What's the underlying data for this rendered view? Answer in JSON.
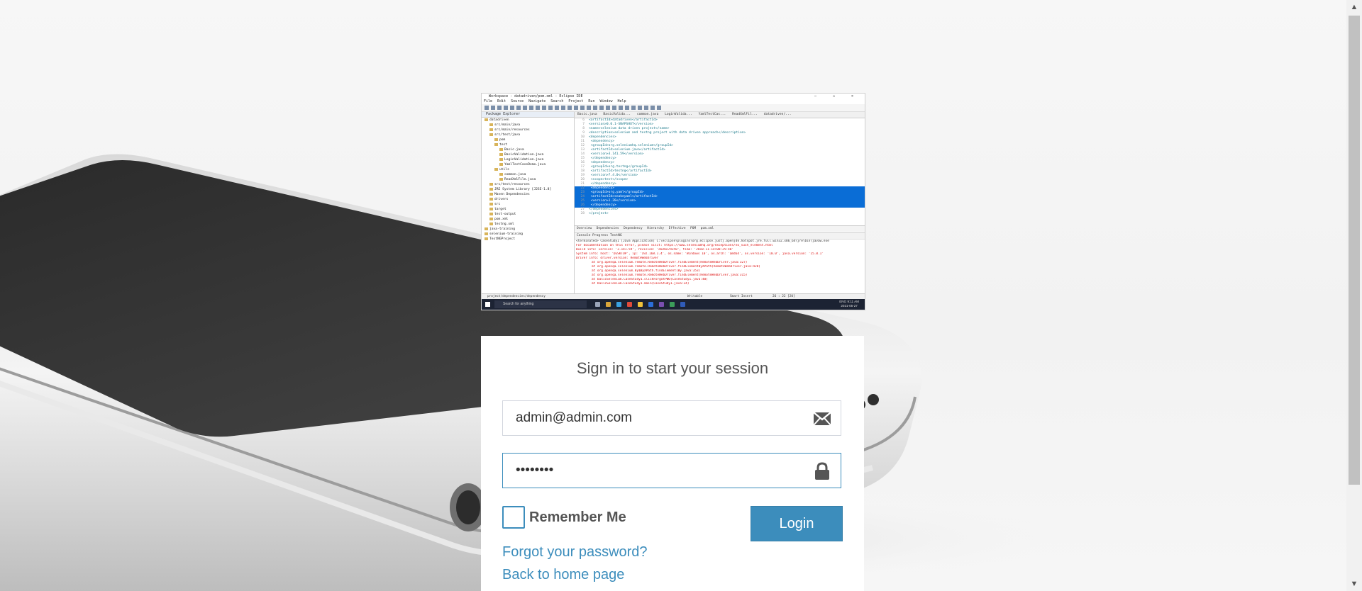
{
  "login": {
    "title": "Sign in to start your session",
    "email_value": "admin@admin.com",
    "password_value": "••••••••",
    "remember_label": "Remember Me",
    "login_button": "Login",
    "forgot_link": "Forgot your password?",
    "home_link": "Back to home page",
    "accent_color": "#3c8dbc"
  },
  "icons": {
    "email": "envelope-icon",
    "password": "lock-icon",
    "scroll_up": "chevron-up-icon",
    "scroll_down": "chevron-down-icon"
  },
  "ide": {
    "window_title": "Workspace - datadriven/pom.xml - Eclipse IDE",
    "menu": "File Edit Source Navigate Search Project Run Window Help",
    "package_explorer_title": "Package Explorer",
    "tree": [
      "datadriven",
      "src/main/java",
      "src/main/resources",
      "src/test/java",
      "pom",
      "test",
      "Basic.java",
      "BasicValidation.java",
      "LoginValidation.java",
      "YamlTestCaseDemo.java",
      "utils",
      "common.java",
      "ReadXmlFile.java",
      "src/test/resources",
      "JRE System Library [J2SE-1.8]",
      "Maven Dependencies",
      "drivers",
      "src",
      "target",
      "test-output",
      "pom.xml",
      "testng.xml",
      "java-training",
      "selenium-training",
      "TestNGProject"
    ],
    "editor_tabs": "Basic.java  BasicValida...  common.java  LoginValida...  YamlTestCas...  ReadXmlFil...  datadriven/...",
    "code": [
      {
        "ln": "6",
        "text": "<artifactId>datadriven</artifactId>",
        "sel": false
      },
      {
        "ln": "7",
        "text": "<version>0.0.1-SNAPSHOT</version>",
        "sel": false
      },
      {
        "ln": "8",
        "text": "<name>selenium data driven project</name>",
        "sel": false
      },
      {
        "ln": "9",
        "text": "<description>selenium and testng project with data driven approach</description>",
        "sel": false
      },
      {
        "ln": "10",
        "text": "<dependencies>",
        "sel": false
      },
      {
        "ln": "11",
        "text": "  <dependency>",
        "sel": false
      },
      {
        "ln": "12",
        "text": "    <groupId>org.seleniumhq.selenium</groupId>",
        "sel": false
      },
      {
        "ln": "13",
        "text": "    <artifactId>selenium-java</artifactId>",
        "sel": false
      },
      {
        "ln": "14",
        "text": "    <version>3.141.59</version>",
        "sel": false
      },
      {
        "ln": "15",
        "text": "  </dependency>",
        "sel": false
      },
      {
        "ln": "16",
        "text": "  <dependency>",
        "sel": false
      },
      {
        "ln": "17",
        "text": "    <groupId>org.testng</groupId>",
        "sel": false
      },
      {
        "ln": "18",
        "text": "    <artifactId>testng</artifactId>",
        "sel": false
      },
      {
        "ln": "19",
        "text": "    <version>7.4.0</version>",
        "sel": false
      },
      {
        "ln": "20",
        "text": "    <scope>test</scope>",
        "sel": false
      },
      {
        "ln": "21",
        "text": "  </dependency>",
        "sel": false
      },
      {
        "ln": "22",
        "text": "  <dependency>",
        "sel": true
      },
      {
        "ln": "23",
        "text": "    <groupId>org.yaml</groupId>",
        "sel": true
      },
      {
        "ln": "24",
        "text": "    <artifactId>snakeyaml</artifactId>",
        "sel": true
      },
      {
        "ln": "25",
        "text": "    <version>1.28</version>",
        "sel": true
      },
      {
        "ln": "26",
        "text": "  </dependency>",
        "sel": true
      },
      {
        "ln": "27",
        "text": "</dependencies>",
        "sel": false
      },
      {
        "ln": "28",
        "text": "</project>",
        "sel": false
      }
    ],
    "pom_tabs": "Overview  Dependencies  Dependency Hierarchy  Effective POM  pom.xml",
    "console_head": "Console  Progress  TestNG",
    "console_lines": [
      {
        "text": "<terminated> CaseStudy1 [Java Application] C:\\eclipse\\plugins\\org.eclipse.justj.openjdk.hotspot.jre.full.win32.x86_64\\jre\\bin\\javaw.exe",
        "indent": false
      },
      {
        "text": "For documentation on this error, please visit: https://www.seleniumhq.org/exceptions/no_such_element.html",
        "indent": false
      },
      {
        "text": "Build info: version: '3.141.59', revision: 'e82be7d358', time: '2018-11-14T08:25:48'",
        "indent": false
      },
      {
        "text": "System info: host: 'DESKTOP', ip: '192.168.1.4', os.name: 'Windows 10', os.arch: 'amd64', os.version: '10.0', java.version: '15.0.1'",
        "indent": false
      },
      {
        "text": "Driver info: driver.version: RemoteWebDriver",
        "indent": false
      },
      {
        "text": "at org.openqa.selenium.remote.RemoteWebDriver.findElement(RemoteWebDriver.java:327)",
        "indent": true
      },
      {
        "text": "at org.openqa.selenium.remote.RemoteWebDriver.findElementByXPath(RemoteWebDriver.java:428)",
        "indent": true
      },
      {
        "text": "at org.openqa.selenium.By$ByXPath.findElement(By.java:353)",
        "indent": true
      },
      {
        "text": "at org.openqa.selenium.remote.RemoteWebDriver.findElement(RemoteWebDriver.java:315)",
        "indent": true
      },
      {
        "text": "at basicSelenium.CaseStudy1.clickForgotPWD(CaseStudy1.java:40)",
        "indent": true
      },
      {
        "text": "at basicSelenium.CaseStudy1.main(CaseStudy1.java:24)",
        "indent": true
      }
    ],
    "status_path": "project/dependencies/dependency",
    "status_writable": "Writable",
    "status_insert": "Smart Insert",
    "status_pos": "26 : 22 [20]",
    "taskbar_search": "Search for anything",
    "clock_time": "9:11 AM",
    "clock_date": "2021-05-27",
    "clock_lang": "ENG"
  }
}
